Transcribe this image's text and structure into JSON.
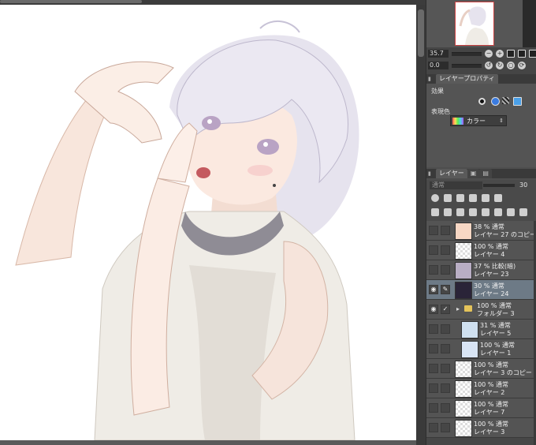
{
  "navigator": {
    "zoom": "35.7",
    "angle": "0.0"
  },
  "property_panel": {
    "tab_label": "レイヤープロパティ",
    "effect_label": "効果",
    "expression_color_label": "表現色",
    "expression_color_value": "カラー"
  },
  "layer_panel": {
    "tab_label": "レイヤー",
    "blend_mode": "通常",
    "opacity": "30",
    "layers": [
      {
        "line1": "38 % 通常",
        "line2": "レイヤー 27 のコピー",
        "selected": false,
        "eye": false,
        "kind": "layer"
      },
      {
        "line1": "100 % 通常",
        "line2": "レイヤー 4",
        "selected": false,
        "eye": false,
        "kind": "layer"
      },
      {
        "line1": "37 % 比較(暗)",
        "line2": "レイヤー 23",
        "selected": false,
        "eye": false,
        "kind": "layer"
      },
      {
        "line1": "30 % 通常",
        "line2": "レイヤー 24",
        "selected": true,
        "eye": true,
        "kind": "layer"
      },
      {
        "line1": "100 % 通常",
        "line2": "フォルダー 3",
        "selected": false,
        "eye": true,
        "kind": "folder"
      },
      {
        "line1": "31 % 通常",
        "line2": "レイヤー 5",
        "selected": false,
        "eye": false,
        "kind": "sublayer"
      },
      {
        "line1": "100 % 通常",
        "line2": "レイヤー 1",
        "selected": false,
        "eye": false,
        "kind": "sublayer"
      },
      {
        "line1": "100 % 通常",
        "line2": "レイヤー 3 のコピー 2",
        "selected": false,
        "eye": false,
        "kind": "layer"
      },
      {
        "line1": "100 % 通常",
        "line2": "レイヤー 2",
        "selected": false,
        "eye": false,
        "kind": "layer"
      },
      {
        "line1": "100 % 通常",
        "line2": "レイヤー 7",
        "selected": false,
        "eye": false,
        "kind": "layer"
      },
      {
        "line1": "100 % 通常",
        "line2": "レイヤー 3",
        "selected": false,
        "eye": false,
        "kind": "layer"
      }
    ]
  },
  "colors": {
    "selected_row": "#6d7a86",
    "panel_bg": "#545454",
    "canvas_bg": "#ffffff"
  }
}
